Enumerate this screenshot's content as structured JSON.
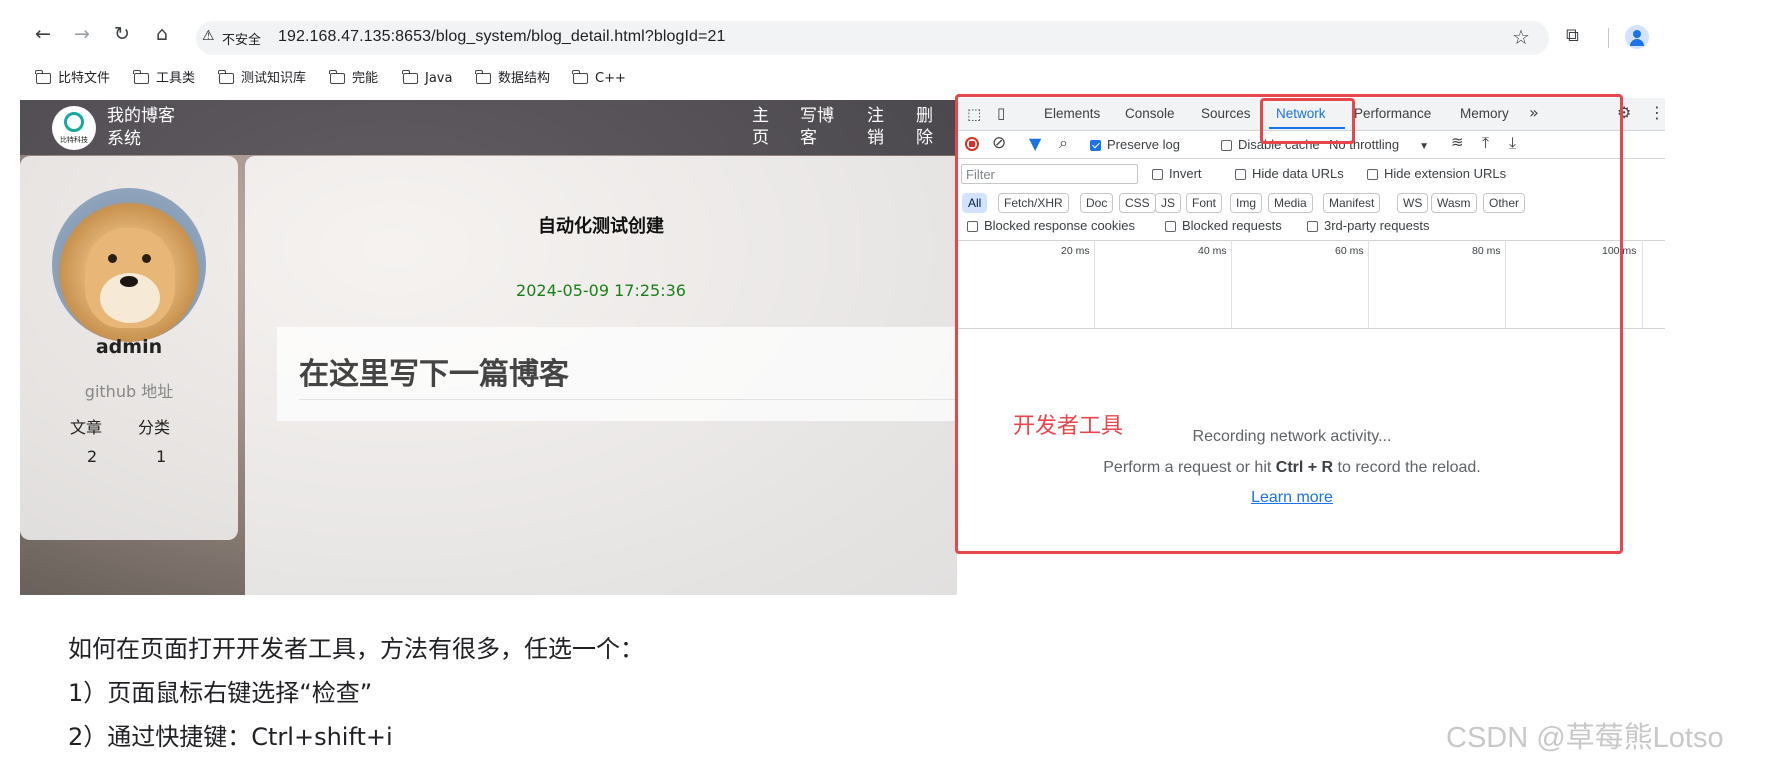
{
  "browser": {
    "security_label": "不安全",
    "url": "192.168.47.135:8653/blog_system/blog_detail.html?blogId=21",
    "bookmarks": [
      "比特文件",
      "工具类",
      "测试知识库",
      "完能",
      "Java",
      "数据结构",
      "C++"
    ]
  },
  "blog": {
    "site_name_line1": "我的博客",
    "site_name_line2": "系统",
    "logo_text": "比特科技",
    "nav": [
      "主页",
      "写博客",
      "注销",
      "删除"
    ],
    "user": {
      "name": "admin",
      "github": "github 地址",
      "stat_labels": [
        "文章",
        "分类"
      ],
      "stat_values": [
        "2",
        "1"
      ]
    },
    "article": {
      "title": "自动化测试创建",
      "date": "2024-05-09 17:25:36",
      "content": "在这里写下一篇博客"
    }
  },
  "devtools": {
    "tabs": [
      "Elements",
      "Console",
      "Sources",
      "Network",
      "Performance",
      "Memory"
    ],
    "active_tab": "Network",
    "preserve_log": "Preserve log",
    "disable_cache": "Disable cache",
    "throttling": "No throttling",
    "filter_placeholder": "Filter",
    "invert": "Invert",
    "hide_data_urls": "Hide data URLs",
    "hide_extension_urls": "Hide extension URLs",
    "type_filters": [
      "All",
      "Fetch/XHR",
      "Doc",
      "CSS",
      "JS",
      "Font",
      "Img",
      "Media",
      "Manifest",
      "WS",
      "Wasm",
      "Other"
    ],
    "blocked_response_cookies": "Blocked response cookies",
    "blocked_requests": "Blocked requests",
    "third_party": "3rd-party requests",
    "ticks": [
      "20 ms",
      "40 ms",
      "60 ms",
      "80 ms",
      "100 ms"
    ],
    "annotation": "开发者工具",
    "recording": "Recording network activity...",
    "hint_prefix": "Perform a request or hit ",
    "hint_key": "Ctrl + R",
    "hint_suffix": " to record the reload.",
    "learn_more": "Learn more"
  },
  "caption": {
    "line1": "如何在页面打开开发者工具，方法有很多，任选一个：",
    "line2": "1）页面鼠标右键选择“检查”",
    "line3": "2）通过快捷键：Ctrl+shift+i"
  },
  "watermark": "CSDN @草莓熊Lotso",
  "colors": {
    "highlight": "#e8464c",
    "date": "#1a7f1a",
    "active_tab": "#1a73e8",
    "link": "#1a73e8"
  }
}
